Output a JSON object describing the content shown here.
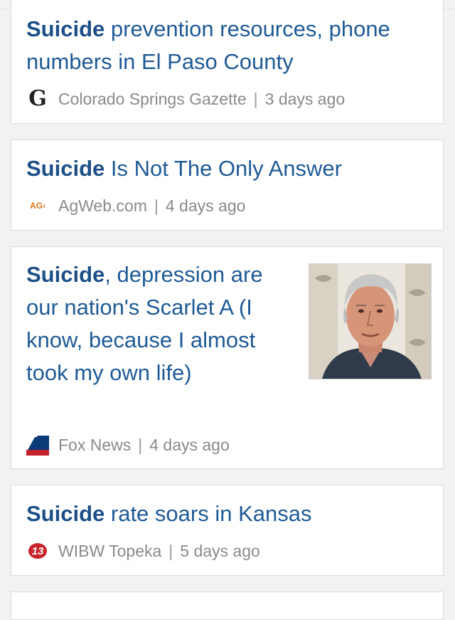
{
  "articles": [
    {
      "keyword": "Suicide",
      "title_rest": " prevention resources, phone numbers in El Paso County",
      "source": "Colorado Springs Gazette",
      "separator": "|",
      "time": "3 days ago",
      "logo_icon": "gazette-logo-icon",
      "logo_text": "G"
    },
    {
      "keyword": "Suicide",
      "title_rest": " Is Not The Only Answer",
      "source": "AgWeb.com",
      "separator": "|",
      "time": "4 days ago",
      "logo_icon": "agweb-logo-icon",
      "logo_text": "AG›"
    },
    {
      "keyword": "Suicide",
      "title_rest": ", depression are our nation's Scarlet A (I know, because I almost took my own life)",
      "source": "Fox News",
      "separator": "|",
      "time": "4 days ago",
      "logo_icon": "fox-news-logo-icon",
      "thumbnail": "man-portrait-photo"
    },
    {
      "keyword": "Suicide",
      "title_rest": " rate soars in Kansas",
      "source": "WIBW Topeka",
      "separator": "|",
      "time": "5 days ago",
      "logo_icon": "wibw-logo-icon",
      "logo_text": "13"
    }
  ],
  "colors": {
    "headline": "#1f5a96",
    "meta": "#8a8a8a",
    "accent": "#e2553f",
    "background": "#f2f2f2"
  }
}
